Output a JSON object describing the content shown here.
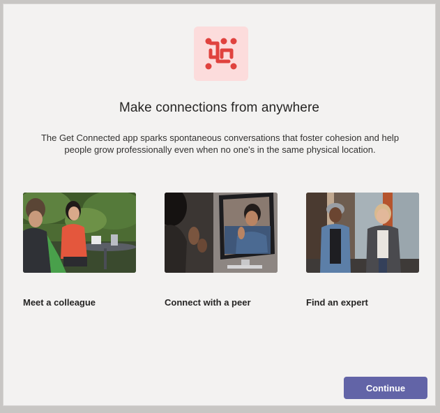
{
  "dialog": {
    "title": "Make connections from anywhere",
    "description": "The Get Connected app sparks spontaneous conversations that foster cohesion and help people grow professionally even when no one's in the same physical location."
  },
  "logo": {
    "icon": "get-connected-logo-icon",
    "tile_color": "#fcdcdc",
    "icon_color": "#e0423e"
  },
  "cards": [
    {
      "label": "Meet a colleague",
      "image": "two colleagues talking at an outdoor table"
    },
    {
      "label": "Connect with a peer",
      "image": "person on a video call with a peer on a monitor"
    },
    {
      "label": "Find an expert",
      "image": "two women walking and talking in a hallway"
    }
  ],
  "actions": {
    "continue_label": "Continue",
    "accent": "#6264a7"
  }
}
